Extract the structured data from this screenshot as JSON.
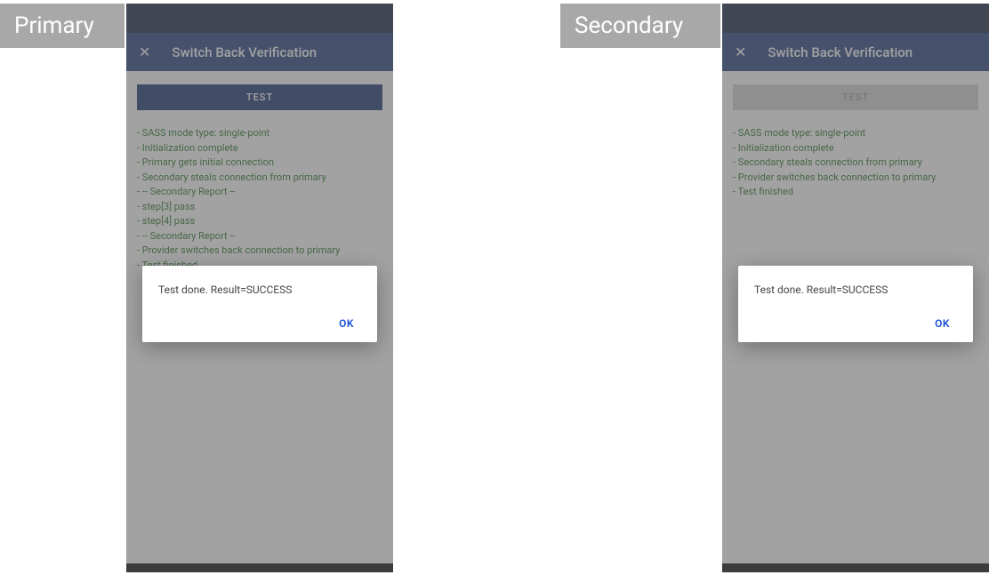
{
  "labels": {
    "primary": "Primary",
    "secondary": "Secondary"
  },
  "common": {
    "title": "Switch Back Verification",
    "test_button": "TEST",
    "dialog_message": "Test done. Result=SUCCESS",
    "dialog_ok": "OK"
  },
  "primary": {
    "test_button_enabled": true,
    "log": [
      "SASS mode type: single-point",
      "Initialization complete",
      "Primary gets initial connection",
      "Secondary steals connection from primary",
      "-- Secondary Report --",
      "step[3] pass",
      "step[4] pass",
      "-- Secondary Report --",
      "Provider switches back connection to primary",
      "Test finished"
    ]
  },
  "secondary": {
    "test_button_enabled": false,
    "log": [
      "SASS mode type: single-point",
      "Initialization complete",
      "Secondary steals connection from primary",
      "Provider switches back connection to primary",
      "Test finished"
    ]
  }
}
